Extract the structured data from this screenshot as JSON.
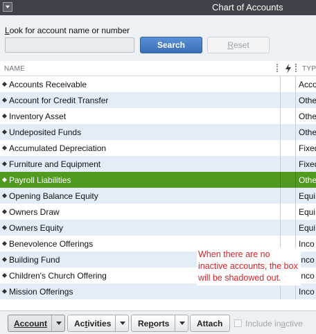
{
  "window": {
    "title": "Chart of Accounts"
  },
  "search": {
    "label_prefix": "L",
    "label_rest": "ook for account name or number",
    "value": "",
    "placeholder": "",
    "search_label": "Search",
    "reset_label_prefix": "R",
    "reset_label_rest": "eset"
  },
  "columns": {
    "name": "NAME",
    "type": "TYP"
  },
  "accounts": [
    {
      "name": "Accounts Receivable",
      "type": "Accou"
    },
    {
      "name": "Account for Credit Transfer",
      "type": "Othe"
    },
    {
      "name": "Inventory Asset",
      "type": "Othe"
    },
    {
      "name": "Undeposited Funds",
      "type": "Othe"
    },
    {
      "name": "Accumulated Depreciation",
      "type": "Fixed"
    },
    {
      "name": "Furniture and Equipment",
      "type": "Fixed"
    },
    {
      "name": "Payroll Liabilities",
      "type": "Othe"
    },
    {
      "name": "Opening Balance Equity",
      "type": "Equi"
    },
    {
      "name": "Owners Draw",
      "type": "Equi"
    },
    {
      "name": "Owners Equity",
      "type": "Equi"
    },
    {
      "name": "Benevolence Offerings",
      "type": "Inco"
    },
    {
      "name": "Building Fund",
      "type": "Inco"
    },
    {
      "name": "Children's Church Offering",
      "type": "Inco"
    },
    {
      "name": "Mission Offerings",
      "type": "Inco"
    }
  ],
  "selected_index": 6,
  "callout": "When there are no inactive accounts, the box will be shadowed out.",
  "footer": {
    "account": "Account",
    "activities_pre": "Ac",
    "activities_u": "t",
    "activities_post": "ivities",
    "reports_pre": "Re",
    "reports_u": "p",
    "reports_post": "orts",
    "attach": "Attach",
    "include_pre": "Include in",
    "include_u": "a",
    "include_post": "ctive"
  },
  "colors": {
    "selected_row": "#4f9a1f",
    "alt_row": "#e3edf8",
    "callout_text": "#d0242a",
    "search_button": "#3a6fb8"
  },
  "icons": {
    "system_menu": "dropdown-box-icon",
    "column_flag": "lightning-icon",
    "row_marker": "diamond-icon"
  }
}
